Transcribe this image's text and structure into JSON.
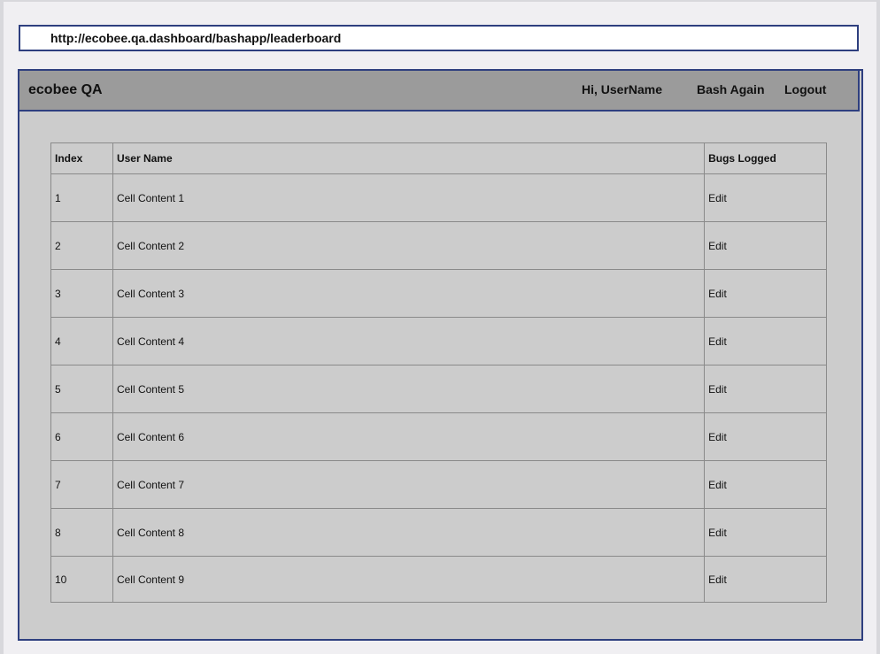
{
  "url": "http://ecobee.qa.dashboard/bashapp/leaderboard",
  "header": {
    "brand": "ecobee QA",
    "greeting": "Hi, UserName",
    "bash_again": "Bash Again",
    "logout": "Logout"
  },
  "table": {
    "columns": [
      "Index",
      "User Name",
      "Bugs Logged"
    ],
    "rows": [
      {
        "index": "1",
        "name": "Cell Content 1",
        "action": "Edit"
      },
      {
        "index": "2",
        "name": "Cell Content 2",
        "action": "Edit"
      },
      {
        "index": "3",
        "name": "Cell Content 3",
        "action": "Edit"
      },
      {
        "index": "4",
        "name": "Cell Content 4",
        "action": "Edit"
      },
      {
        "index": "5",
        "name": "Cell Content 5",
        "action": "Edit"
      },
      {
        "index": "6",
        "name": "Cell Content 6",
        "action": "Edit"
      },
      {
        "index": "7",
        "name": "Cell Content 7",
        "action": "Edit"
      },
      {
        "index": "8",
        "name": "Cell Content 8",
        "action": "Edit"
      },
      {
        "index": "10",
        "name": "Cell Content 9",
        "action": "Edit"
      }
    ]
  }
}
